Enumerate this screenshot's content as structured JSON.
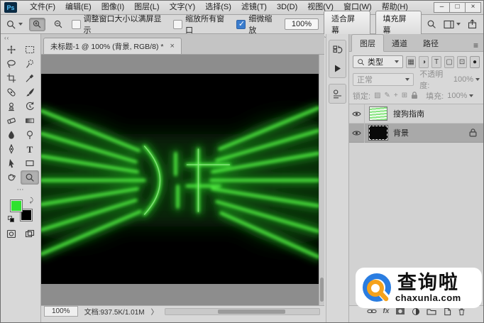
{
  "menu_bar": {
    "app_label": "Ps",
    "items": [
      "文件(F)",
      "编辑(E)",
      "图像(I)",
      "图层(L)",
      "文字(Y)",
      "选择(S)",
      "滤镜(T)",
      "3D(D)",
      "视图(V)",
      "窗口(W)",
      "帮助(H)"
    ],
    "window_controls": {
      "minimize": "–",
      "maximize": "□",
      "close": "×"
    }
  },
  "options_bar": {
    "tool_icon": "zoom-tool-icon",
    "checkbox_resize_label": "调整窗口大小以满屏显示",
    "checkbox_resize_checked": false,
    "checkbox_all_windows_label": "缩放所有窗口",
    "checkbox_all_windows_checked": false,
    "checkbox_scrubby_label": "细微缩放",
    "checkbox_scrubby_checked": true,
    "zoom_value": "100%",
    "fit_screen_label": "适合屏幕",
    "fill_screen_label": "填充屏幕",
    "right_icons": [
      "search-icon",
      "workspace-switcher-icon",
      "share-icon"
    ]
  },
  "toolbar": {
    "tools": [
      "move-tool",
      "rectangular-marquee-tool",
      "lasso-tool",
      "quick-selection-tool",
      "crop-tool",
      "eyedropper-tool",
      "spot-healing-brush-tool",
      "brush-tool",
      "clone-stamp-tool",
      "history-brush-tool",
      "eraser-tool",
      "gradient-tool",
      "blur-tool",
      "dodge-tool",
      "pen-tool",
      "type-tool",
      "path-selection-tool",
      "rectangle-tool",
      "hand-tool",
      "zoom-tool"
    ],
    "active_tool": "zoom-tool",
    "ellipsis": "⋯",
    "foreground_color": "#2ee22e",
    "background_color": "#000000"
  },
  "document": {
    "tab_title": "未标题-1 @ 100% (背景, RGB/8) *",
    "close_glyph": "×",
    "status_zoom": "100%",
    "status_doc": "文档:937.5K/1.01M",
    "status_arrow": "〉",
    "canvas_green": "#35e435",
    "canvas_background": "#000000"
  },
  "mini_dock": {
    "icons": [
      "history-panel-icon",
      "actions-panel-icon",
      "properties-panel-icon"
    ]
  },
  "panels": {
    "tabs": [
      "图层",
      "通道",
      "路径"
    ],
    "active_tab": "图层",
    "panel_menu_icon": "≡",
    "filter_label": "类型",
    "filter_icons": [
      "pixel-layers-filter-icon",
      "adjustment-layers-filter-icon",
      "type-layers-filter-icon",
      "shape-layers-filter-icon",
      "smart-objects-filter-icon",
      "filter-toggle-icon"
    ],
    "filter_glyphs": {
      "pixel": "▦",
      "adjustment": "◑",
      "type": "T",
      "shape": "▢",
      "smart": "⊡",
      "toggle": "●"
    },
    "blend_mode": "正常",
    "opacity_label": "不透明度:",
    "opacity_value": "100%",
    "lock_label": "锁定:",
    "lock_glyphs": {
      "transparent": "▨",
      "pixels": "✎",
      "position": "+",
      "artboard": "⊞"
    },
    "fill_label": "填充:",
    "fill_value": "100%",
    "layers": [
      {
        "name": "搜狗指南",
        "visible": true,
        "selected": false,
        "locked": false
      },
      {
        "name": "背景",
        "visible": true,
        "selected": true,
        "locked": true
      }
    ],
    "bottom_icons": [
      "link-layers-icon",
      "layer-style-icon",
      "layer-mask-icon",
      "adjustment-layer-icon",
      "layer-group-icon",
      "new-layer-icon",
      "delete-layer-icon"
    ],
    "fx_label": "fx"
  },
  "watermark": {
    "title": "查询啦",
    "domain": "chaxunla.com",
    "brand_blue": "#2a7de1",
    "brand_orange": "#f5a21c"
  }
}
